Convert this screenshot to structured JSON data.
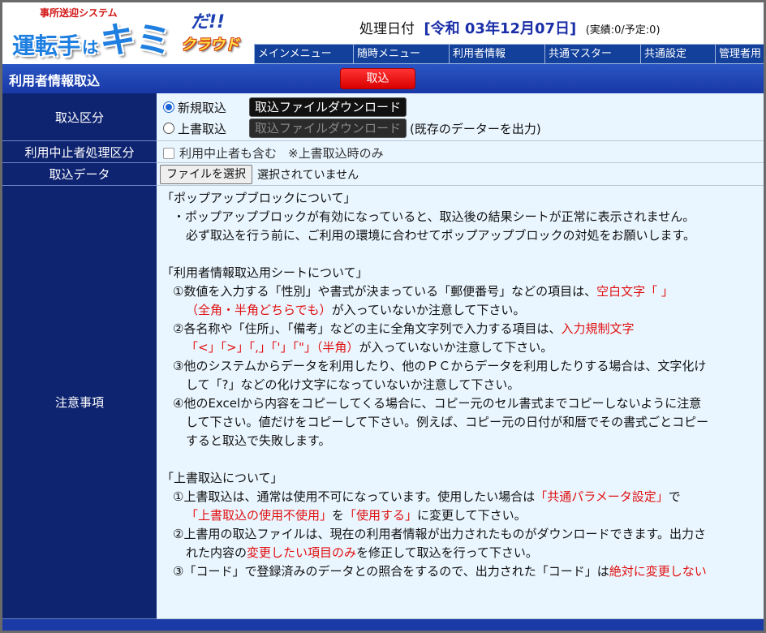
{
  "logo": {
    "tagline": "事所送迎システム",
    "word1": "運転手",
    "word2": "は",
    "word3": "キミ",
    "word4": "だ!!",
    "word5": "クラウド"
  },
  "header": {
    "date_label": "処理日付",
    "date_value": "[令和 03年12月07日]",
    "date_extra": "(実績:0/予定:0)"
  },
  "nav": [
    {
      "label": "メインメニュー",
      "width": 122
    },
    {
      "label": "随時メニュー",
      "width": 118
    },
    {
      "label": "利用者情報",
      "width": 118
    },
    {
      "label": "共通マスター",
      "width": 118
    },
    {
      "label": "共通設定",
      "width": 92
    },
    {
      "label": "管理者用",
      "width": 60
    }
  ],
  "titlebar": {
    "title": "利用者情報取込",
    "import_button": "取込"
  },
  "form": {
    "import_type": {
      "label": "取込区分",
      "opt_new": "新規取込",
      "opt_overwrite": "上書取込",
      "download_btn": "取込ファイルダウンロード",
      "download_btn2": "取込ファイルダウンロード",
      "download_note": "(既存のデーターを出力)",
      "selected": "new"
    },
    "suspended": {
      "label": "利用中止者処理区分",
      "checkbox_label": "利用中止者も含む",
      "note": "※上書取込時のみ",
      "checked": false
    },
    "import_data": {
      "label": "取込データ",
      "file_button": "ファイルを選択",
      "file_status": "選択されていません"
    },
    "notes": {
      "label": "注意事項",
      "popup_head": "「ポップアップブロックについて」",
      "popup_l1": "・ポップアップブロックが有効になっていると、取込後の結果シートが正常に表示されません。",
      "popup_l2": "必ず取込を行う前に、ご利用の環境に合わせてポップアップブロックの対処をお願いします。",
      "sheet_head": "「利用者情報取込用シートについて」",
      "s1_a": "①数値を入力する「性別」や書式が決まっている「郵便番号」などの項目は、",
      "s1_red": "空白文字「 」",
      "s1_b_red": "（全角・半角どちらでも）",
      "s1_b": "が入っていないか注意して下さい。",
      "s2_a": "②各名称や「住所」、「備考」などの主に全角文字列で入力する項目は、",
      "s2_red": "入力規制文字",
      "s2_b_red": "「<」「>」「,」「'」「\"」（半角）",
      "s2_b": "が入っていないか注意して下さい。",
      "s3_a": "③他のシステムからデータを利用したり、他のＰＣからデータを利用したりする場合は、文字化け",
      "s3_b": "して「?」などの化け文字になっていないか注意して下さい。",
      "s4_a": "④他のExcelから内容をコピーしてくる場合に、コピー元のセル書式までコピーしないように注意",
      "s4_b": "して下さい。値だけをコピーして下さい。例えば、コピー元の日付が和暦でその書式ごとコピー",
      "s4_c": "すると取込で失敗します。",
      "over_head": "「上書取込について」",
      "o1_a": "①上書取込は、通常は使用不可になっています。使用したい場合は",
      "o1_red": "「共通パラメータ設定」",
      "o1_a2": "で",
      "o1_b_red1": "「上書取込の使用不使用」",
      "o1_b_mid": "を",
      "o1_b_red2": "「使用する」",
      "o1_b_end": "に変更して下さい。",
      "o2_a": "②上書用の取込ファイルは、現在の利用者情報が出力されたものがダウンロードできます。出力さ",
      "o2_b1": "れた内容の",
      "o2_b_red": "変更したい項目のみ",
      "o2_b2": "を修正して取込を行って下さい。",
      "o3_a": "③「コード」で登録済みのデータとの照合をするので、出力された「コード」は",
      "o3_red": "絶対に変更しない"
    }
  },
  "colors": {
    "nav_bg": "#12409a",
    "label_bg": "#0f2470",
    "content_bg": "#eaf6ff",
    "accent_red": "#e01010",
    "date_blue": "#1a2fa8"
  }
}
